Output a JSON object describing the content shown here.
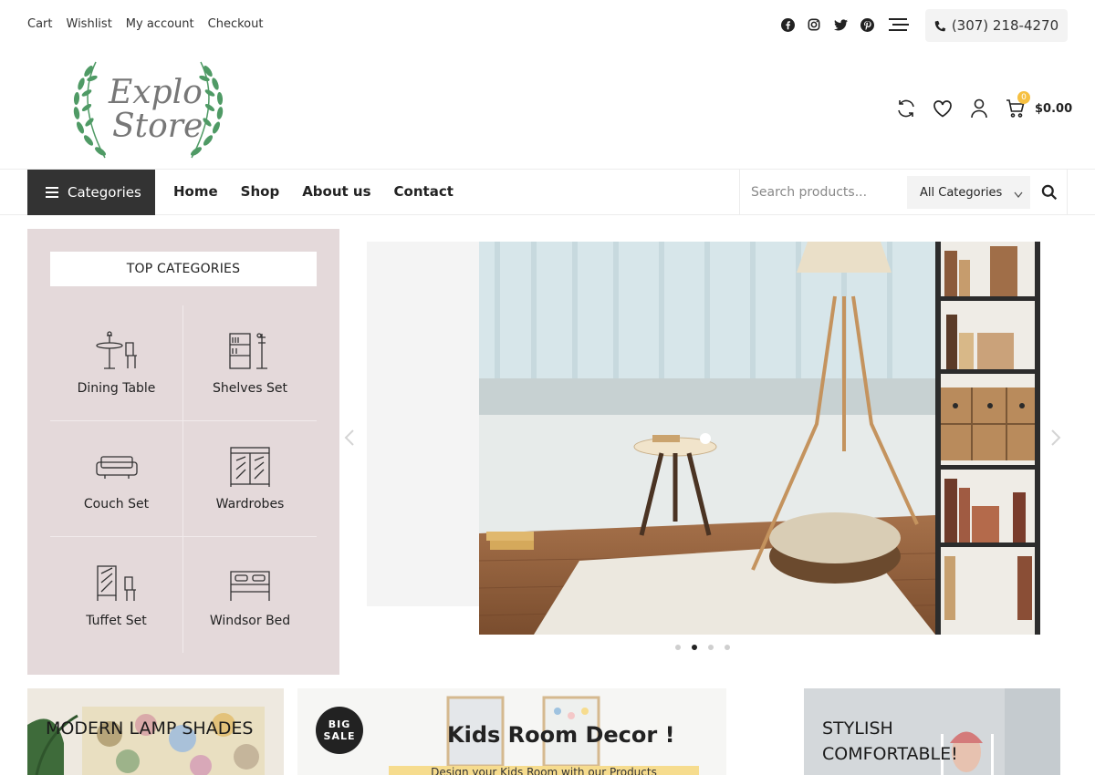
{
  "top_links": [
    "Cart",
    "Wishlist",
    "My account",
    "Checkout"
  ],
  "socials": [
    "facebook-icon",
    "instagram-icon",
    "twitter-icon",
    "pinterest-icon"
  ],
  "phone": "(307) 218-4270",
  "logo_text": "Explo Store",
  "cart": {
    "count": "0",
    "total": "$0.00"
  },
  "nav": {
    "categories_label": "Categories",
    "links": [
      "Home",
      "Shop",
      "About us",
      "Contact"
    ]
  },
  "search": {
    "placeholder": "Search products...",
    "category_selected": "All Categories"
  },
  "top_categories": {
    "title": "TOP CATEGORIES",
    "items": [
      "Dining Table",
      "Shelves Set",
      "Couch Set",
      "Wardrobes",
      "Tuffet Set",
      "Windsor Bed"
    ]
  },
  "slider": {
    "dot_count": 4,
    "active_dot": 2
  },
  "banners": {
    "lamp": "MODERN LAMP SHADES",
    "sale_badge": "BIG SALE",
    "kids": "Kids Room Decor !",
    "kids_sub": "Design your Kids Room with our Products",
    "stylish": "STYLISH COMFORTABLE!"
  },
  "colors": {
    "dark": "#333333",
    "panel": "#e4d9da",
    "badge": "#f6c042",
    "logo_leaf": "#4f9a65"
  }
}
